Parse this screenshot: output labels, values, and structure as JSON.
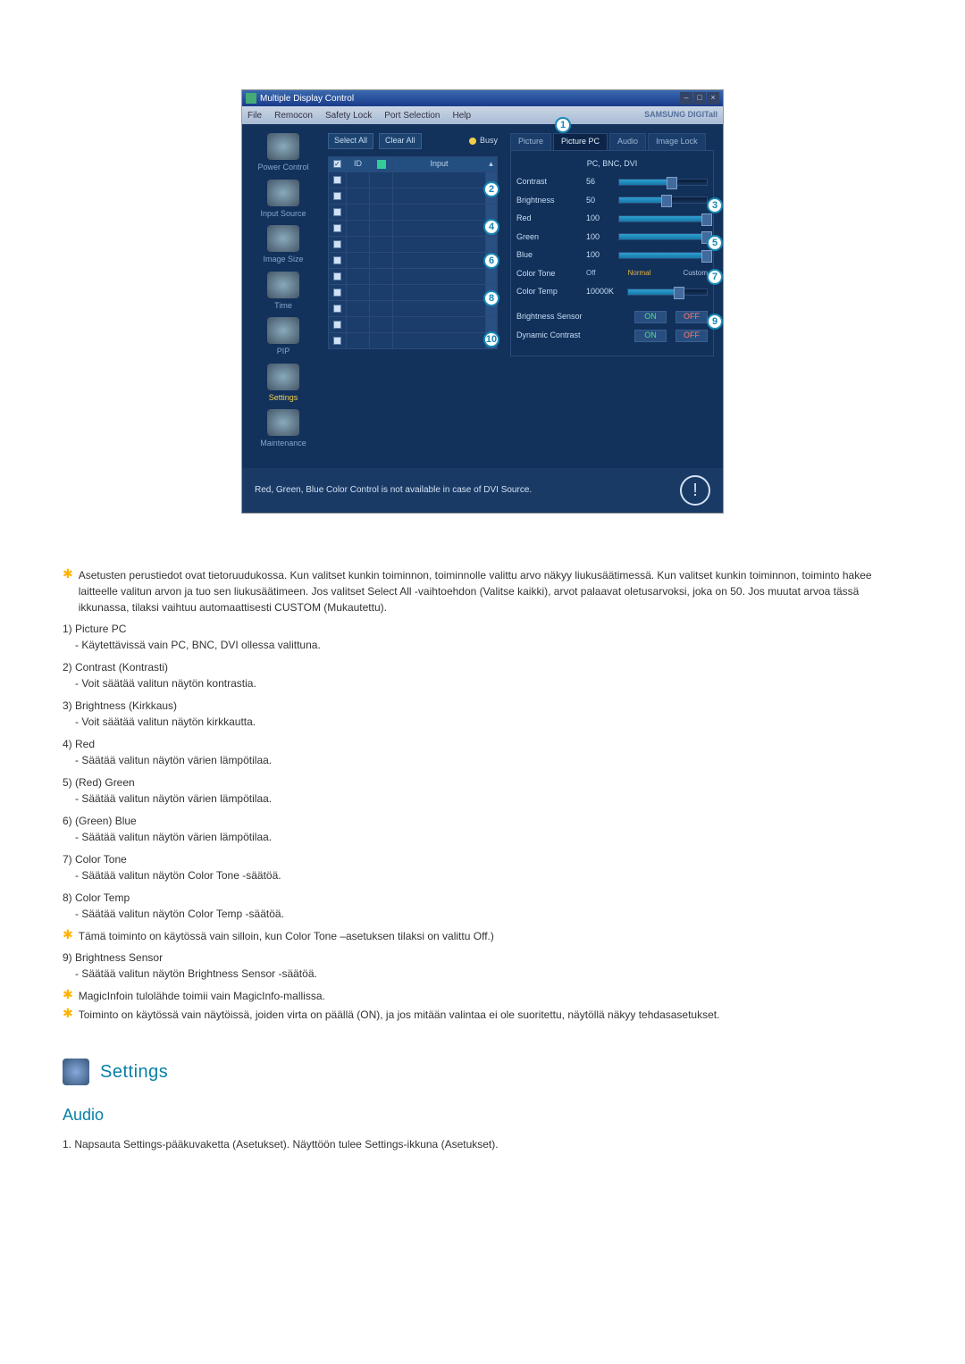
{
  "app": {
    "title": "Multiple Display Control",
    "brand": "SAMSUNG DIGITall"
  },
  "menu": {
    "file": "File",
    "remocon": "Remocon",
    "safety": "Safety Lock",
    "port": "Port Selection",
    "help": "Help"
  },
  "sidebar": [
    {
      "label": "Power Control"
    },
    {
      "label": "Input Source"
    },
    {
      "label": "Image Size"
    },
    {
      "label": "Time"
    },
    {
      "label": "PIP"
    },
    {
      "label": "Settings",
      "selected": true
    },
    {
      "label": "Maintenance"
    }
  ],
  "toolbar": {
    "select_all": "Select All",
    "clear_all": "Clear All",
    "busy": "Busy"
  },
  "grid": {
    "cols": {
      "id": "ID",
      "input": "Input"
    }
  },
  "tabs": {
    "picture": "Picture",
    "picture_pc": "Picture PC",
    "audio": "Audio",
    "image_lock": "Image Lock"
  },
  "mode": "PC, BNC, DVI",
  "params": {
    "contrast": {
      "label": "Contrast",
      "value": "56",
      "pct": 56
    },
    "brightness": {
      "label": "Brightness",
      "value": "50",
      "pct": 50
    },
    "red": {
      "label": "Red",
      "value": "100",
      "pct": 100
    },
    "green": {
      "label": "Green",
      "value": "100",
      "pct": 100
    },
    "blue": {
      "label": "Blue",
      "value": "100",
      "pct": 100
    },
    "color_tone": {
      "label": "Color Tone",
      "options": [
        "Off",
        "Normal",
        "Custom"
      ],
      "selected": "Normal"
    },
    "color_temp": {
      "label": "Color Temp",
      "value": "10000K",
      "pct": 60
    },
    "brightness_sensor": {
      "label": "Brightness Sensor",
      "on": "ON",
      "off": "OFF"
    },
    "dynamic_contrast": {
      "label": "Dynamic Contrast",
      "on": "ON",
      "off": "OFF"
    }
  },
  "callouts": {
    "c1": "1",
    "c2": "2",
    "c3": "3",
    "c4": "4",
    "c5": "5",
    "c6": "6",
    "c7": "7",
    "c8": "8",
    "c9": "9",
    "c10": "10"
  },
  "footer": "Red, Green, Blue Color Control is not available in case of DVI Source.",
  "text": {
    "blurb1": "Asetusten perustiedot ovat tietoruudukossa. Kun valitset kunkin toiminnon, toiminnolle valittu arvo näkyy liukusäätimessä. Kun valitset kunkin toiminnon, toiminto hakee laitteelle valitun arvon ja tuo sen liukusäätimeen. Jos valitset Select All -vaihtoehdon (Valitse kaikki), arvot palaavat oletusarvoksi, joka on 50. Jos muutat arvoa tässä ikkunassa, tilaksi vaihtuu automaattisesti CUSTOM (Mukautettu).",
    "items": [
      {
        "n": "1)",
        "title": "Picture PC",
        "desc": "- Käytettävissä vain PC, BNC, DVI ollessa valittuna."
      },
      {
        "n": "2)",
        "title": "Contrast (Kontrasti)",
        "desc": "- Voit säätää valitun näytön kontrastia."
      },
      {
        "n": "3)",
        "title": "Brightness (Kirkkaus)",
        "desc": "- Voit säätää valitun näytön kirkkautta."
      },
      {
        "n": "4)",
        "title": "Red",
        "desc": "- Säätää valitun näytön värien lämpötilaa."
      },
      {
        "n": "5)",
        "title": "(Red) Green",
        "desc": "- Säätää valitun näytön värien lämpötilaa."
      },
      {
        "n": "6)",
        "title": "(Green) Blue",
        "desc": "- Säätää valitun näytön värien lämpötilaa."
      },
      {
        "n": "7)",
        "title": "Color Tone",
        "desc": "- Säätää valitun näytön Color Tone -säätöä."
      },
      {
        "n": "8)",
        "title": "Color Temp",
        "desc": "- Säätää valitun näytön Color Temp -säätöä."
      }
    ],
    "star2": "Tämä toiminto on käytössä vain silloin, kun Color Tone –asetuksen tilaksi on valittu Off.)",
    "item9": {
      "n": "9)",
      "title": "Brightness Sensor",
      "desc": "- Säätää valitun näytön Brightness Sensor -säätöä."
    },
    "star3": "MagicInfoin tulolähde toimii vain MagicInfo-mallissa.",
    "star4": "Toiminto on käytössä vain näytöissä, joiden virta on päällä (ON), ja jos mitään valintaa ei ole suoritettu, näytöllä näkyy tehdasasetukset.",
    "section": "Settings",
    "audio": "Audio",
    "audio1": "1.  Napsauta Settings-pääkuvaketta (Asetukset). Näyttöön tulee Settings-ikkuna (Asetukset)."
  }
}
